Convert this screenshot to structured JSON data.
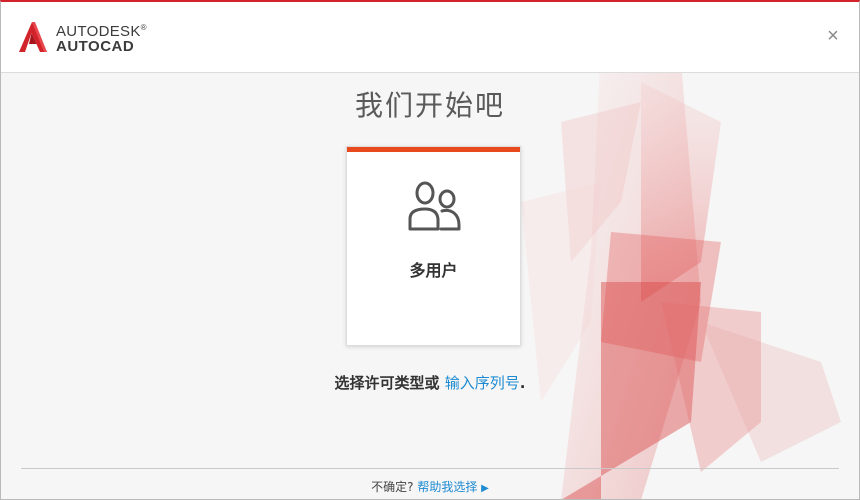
{
  "header": {
    "brand_line1": "AUTODESK",
    "brand_line2": "AUTOCAD",
    "brand_reg": "®",
    "close_glyph": "×"
  },
  "main": {
    "title": "我们开始吧",
    "card": {
      "label": "多用户",
      "icon": "multi-user-icon"
    },
    "prompt_text": "选择许可类型或 ",
    "prompt_link": "输入序列号",
    "prompt_end": "."
  },
  "footer": {
    "question": "不确定? ",
    "help_link": "帮助我选择",
    "arrow": "▶"
  },
  "colors": {
    "accent": "#e8491d",
    "brand_red": "#d2232a",
    "link": "#1d8ad1"
  }
}
